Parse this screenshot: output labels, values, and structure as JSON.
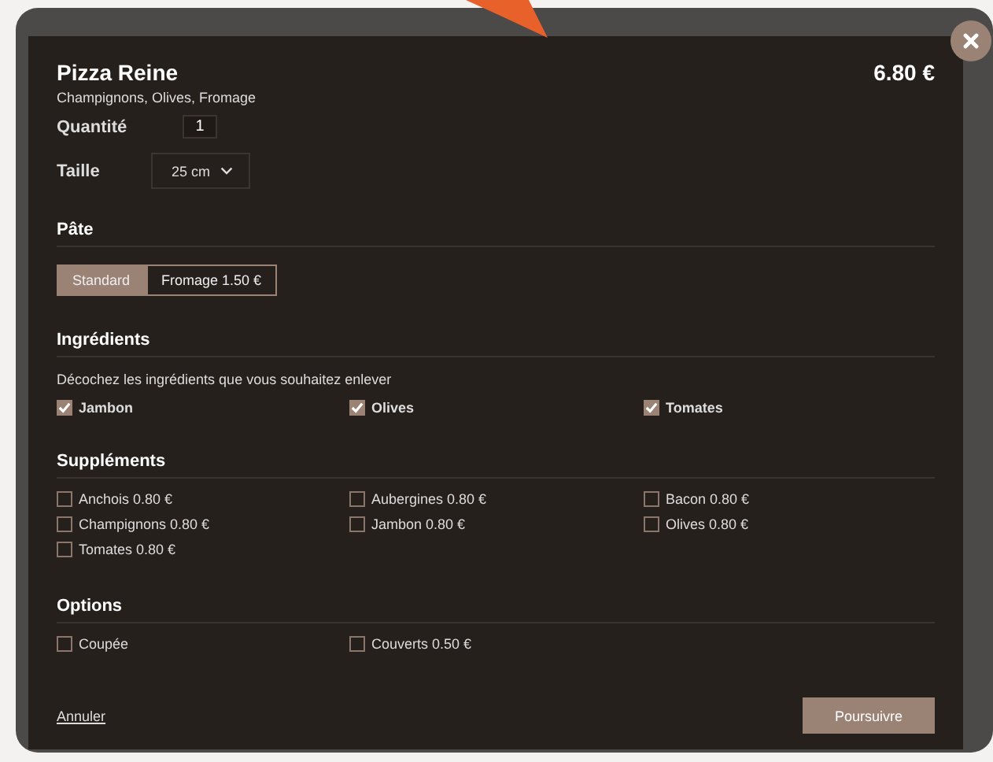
{
  "product": {
    "name": "Pizza Reine",
    "description": "Champignons, Olives, Fromage",
    "price": "6.80 €"
  },
  "quantity": {
    "label": "Quantité",
    "value": "1"
  },
  "size": {
    "label": "Taille",
    "value": "25 cm"
  },
  "dough": {
    "title": "Pâte",
    "options": [
      {
        "label": "Standard",
        "selected": true
      },
      {
        "label": "Fromage 1.50 €",
        "selected": false
      }
    ]
  },
  "ingredients": {
    "title": "Ingrédients",
    "hint": "Décochez les ingrédients que vous souhaitez enlever",
    "items": [
      {
        "label": "Jambon",
        "checked": true
      },
      {
        "label": "Olives",
        "checked": true
      },
      {
        "label": "Tomates",
        "checked": true
      }
    ]
  },
  "supplements": {
    "title": "Suppléments",
    "items": [
      {
        "label": "Anchois 0.80 €",
        "checked": false
      },
      {
        "label": "Aubergines 0.80 €",
        "checked": false
      },
      {
        "label": "Bacon 0.80 €",
        "checked": false
      },
      {
        "label": "Champignons 0.80 €",
        "checked": false
      },
      {
        "label": "Jambon 0.80 €",
        "checked": false
      },
      {
        "label": "Olives 0.80 €",
        "checked": false
      },
      {
        "label": "Tomates 0.80 €",
        "checked": false
      }
    ]
  },
  "options": {
    "title": "Options",
    "items": [
      {
        "label": "Coupée",
        "checked": false
      },
      {
        "label": "Couverts 0.50 €",
        "checked": false
      }
    ]
  },
  "footer": {
    "cancel": "Annuler",
    "submit": "Poursuivre"
  }
}
